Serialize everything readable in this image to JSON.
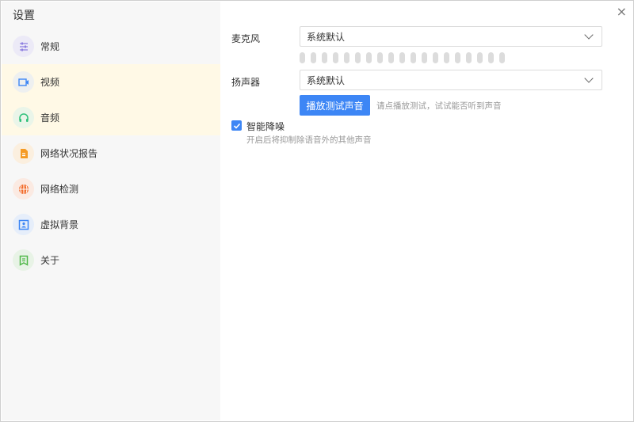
{
  "sidebar": {
    "title": "设置",
    "items": [
      {
        "label": "常规",
        "icon": "sliders-icon",
        "color": "#8c7ee0",
        "bg": "#eceaf7"
      },
      {
        "label": "视频",
        "icon": "video-camera-icon",
        "color": "#3d86f5",
        "bg": "#eef0f0"
      },
      {
        "label": "音频",
        "icon": "headphones-icon",
        "color": "#2ec07a",
        "bg": "#eaf5e9"
      },
      {
        "label": "网络状况报告",
        "icon": "document-icon",
        "color": "#f59a23",
        "bg": "#fbefdf"
      },
      {
        "label": "网络检测",
        "icon": "globe-icon",
        "color": "#f26b2a",
        "bg": "#fbeae2"
      },
      {
        "label": "虚拟背景",
        "icon": "portrait-icon",
        "color": "#3d86f5",
        "bg": "#e6eefa"
      },
      {
        "label": "关于",
        "icon": "info-book-icon",
        "color": "#4fb848",
        "bg": "#e8f3e6"
      }
    ],
    "highlighted": [
      1,
      2
    ]
  },
  "audio": {
    "mic_label": "麦克风",
    "mic_value": "系统默认",
    "mic_level": 0,
    "speaker_label": "扬声器",
    "speaker_value": "系统默认",
    "play_button": "播放测试声音",
    "play_hint": "请点播放测试，试试能否听到声音",
    "noise_label": "智能降噪",
    "noise_checked": true,
    "noise_desc": "开启后将抑制除语音外的其他声音"
  },
  "close_icon": "×",
  "accent": "#3d86f5"
}
